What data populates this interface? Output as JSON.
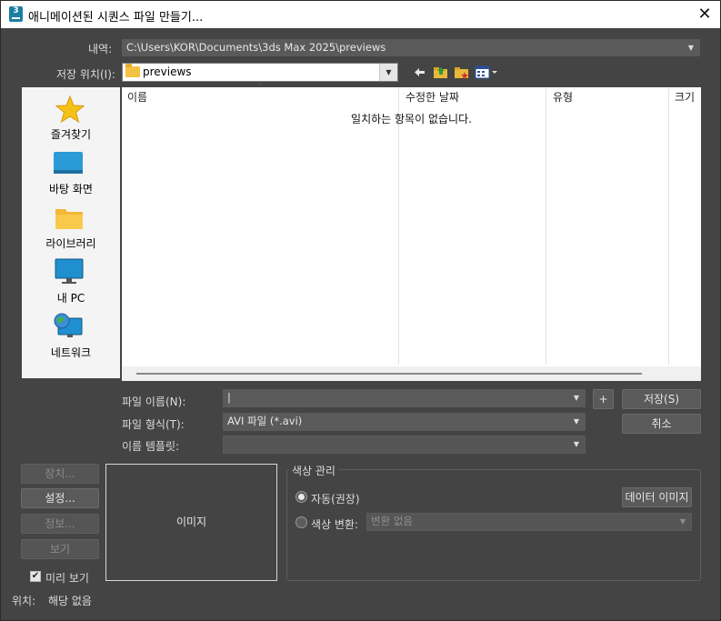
{
  "window": {
    "title": "애니메이션된 시퀀스 파일 만들기...",
    "app_icon_label": "3",
    "close_glyph": "✕"
  },
  "history": {
    "label": "내역:",
    "value": "C:\\Users\\KOR\\Documents\\3ds Max 2025\\previews"
  },
  "save_in": {
    "label": "저장 위치(I):",
    "value": "previews"
  },
  "toolbar": {
    "icons": [
      "back-arrow-icon",
      "up-folder-icon",
      "new-folder-icon",
      "view-menu-icon"
    ]
  },
  "places": [
    {
      "label": "즐겨찾기",
      "icon": "star-icon"
    },
    {
      "label": "바탕 화면",
      "icon": "desktop-icon"
    },
    {
      "label": "라이브러리",
      "icon": "library-folder-icon"
    },
    {
      "label": "내 PC",
      "icon": "monitor-icon"
    },
    {
      "label": "네트워크",
      "icon": "network-globe-icon"
    }
  ],
  "file_list": {
    "columns": [
      "이름",
      "수정한 날짜",
      "유형",
      "크기"
    ],
    "empty_message": "일치하는 항목이 없습니다."
  },
  "form": {
    "filename_label": "파일 이름(N):",
    "filename_value": "|",
    "filetype_label": "파일 형식(T):",
    "filetype_value": "AVI 파일 (*.avi)",
    "template_label": "이름 템플릿:",
    "template_value": "",
    "plus_label": "+",
    "save_label": "저장(S)",
    "cancel_label": "취소"
  },
  "left_buttons": {
    "devices": "장치...",
    "setup": "설정...",
    "info": "정보...",
    "view": "보기"
  },
  "preview": {
    "image_label": "이미지",
    "checkbox_label": "미리 보기",
    "checked": true
  },
  "color_management": {
    "title": "색상 관리",
    "automatic_label": "자동(권장)",
    "automatic_selected": true,
    "data_image_label": "데이터 이미지",
    "conversion_label": "색상 변환:",
    "conversion_value": "변환 없음"
  },
  "status": {
    "location_label": "위치:",
    "location_value": "해당 없음"
  }
}
